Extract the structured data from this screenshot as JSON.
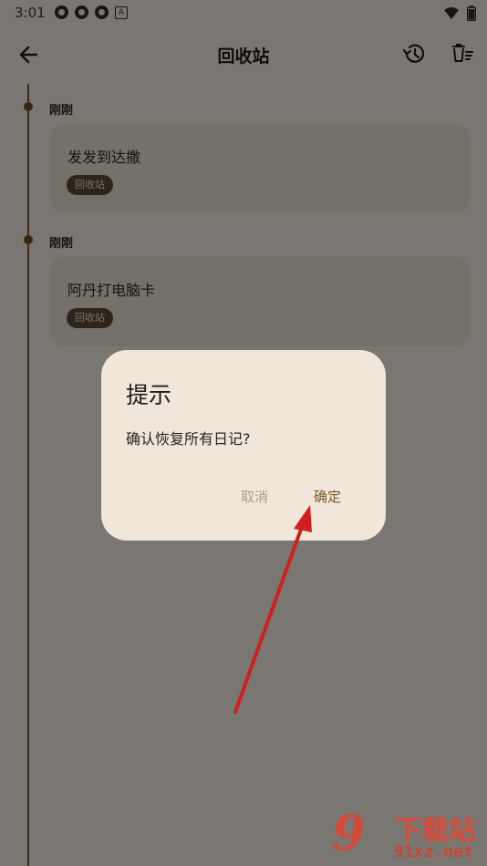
{
  "status_bar": {
    "time": "3:01",
    "notif_badge": "A"
  },
  "app_bar": {
    "title": "回收站"
  },
  "entries": [
    {
      "date": "刚刚",
      "title": "发发到达撒",
      "tag": "回收站"
    },
    {
      "date": "刚刚",
      "title": "阿丹打电脑卡",
      "tag": "回收站"
    }
  ],
  "dialog": {
    "title": "提示",
    "message": "确认恢复所有日记?",
    "cancel_label": "取消",
    "confirm_label": "确定"
  },
  "watermark": {
    "brand": "下载站",
    "site": "91xz.net",
    "logo": "9"
  },
  "colors": {
    "accent": "#7a5a22",
    "arrow": "#d01f1f",
    "badge_bg": "#5a4a34",
    "card_bg": "#e9e2d6",
    "dialog_bg": "#f0e6da"
  }
}
